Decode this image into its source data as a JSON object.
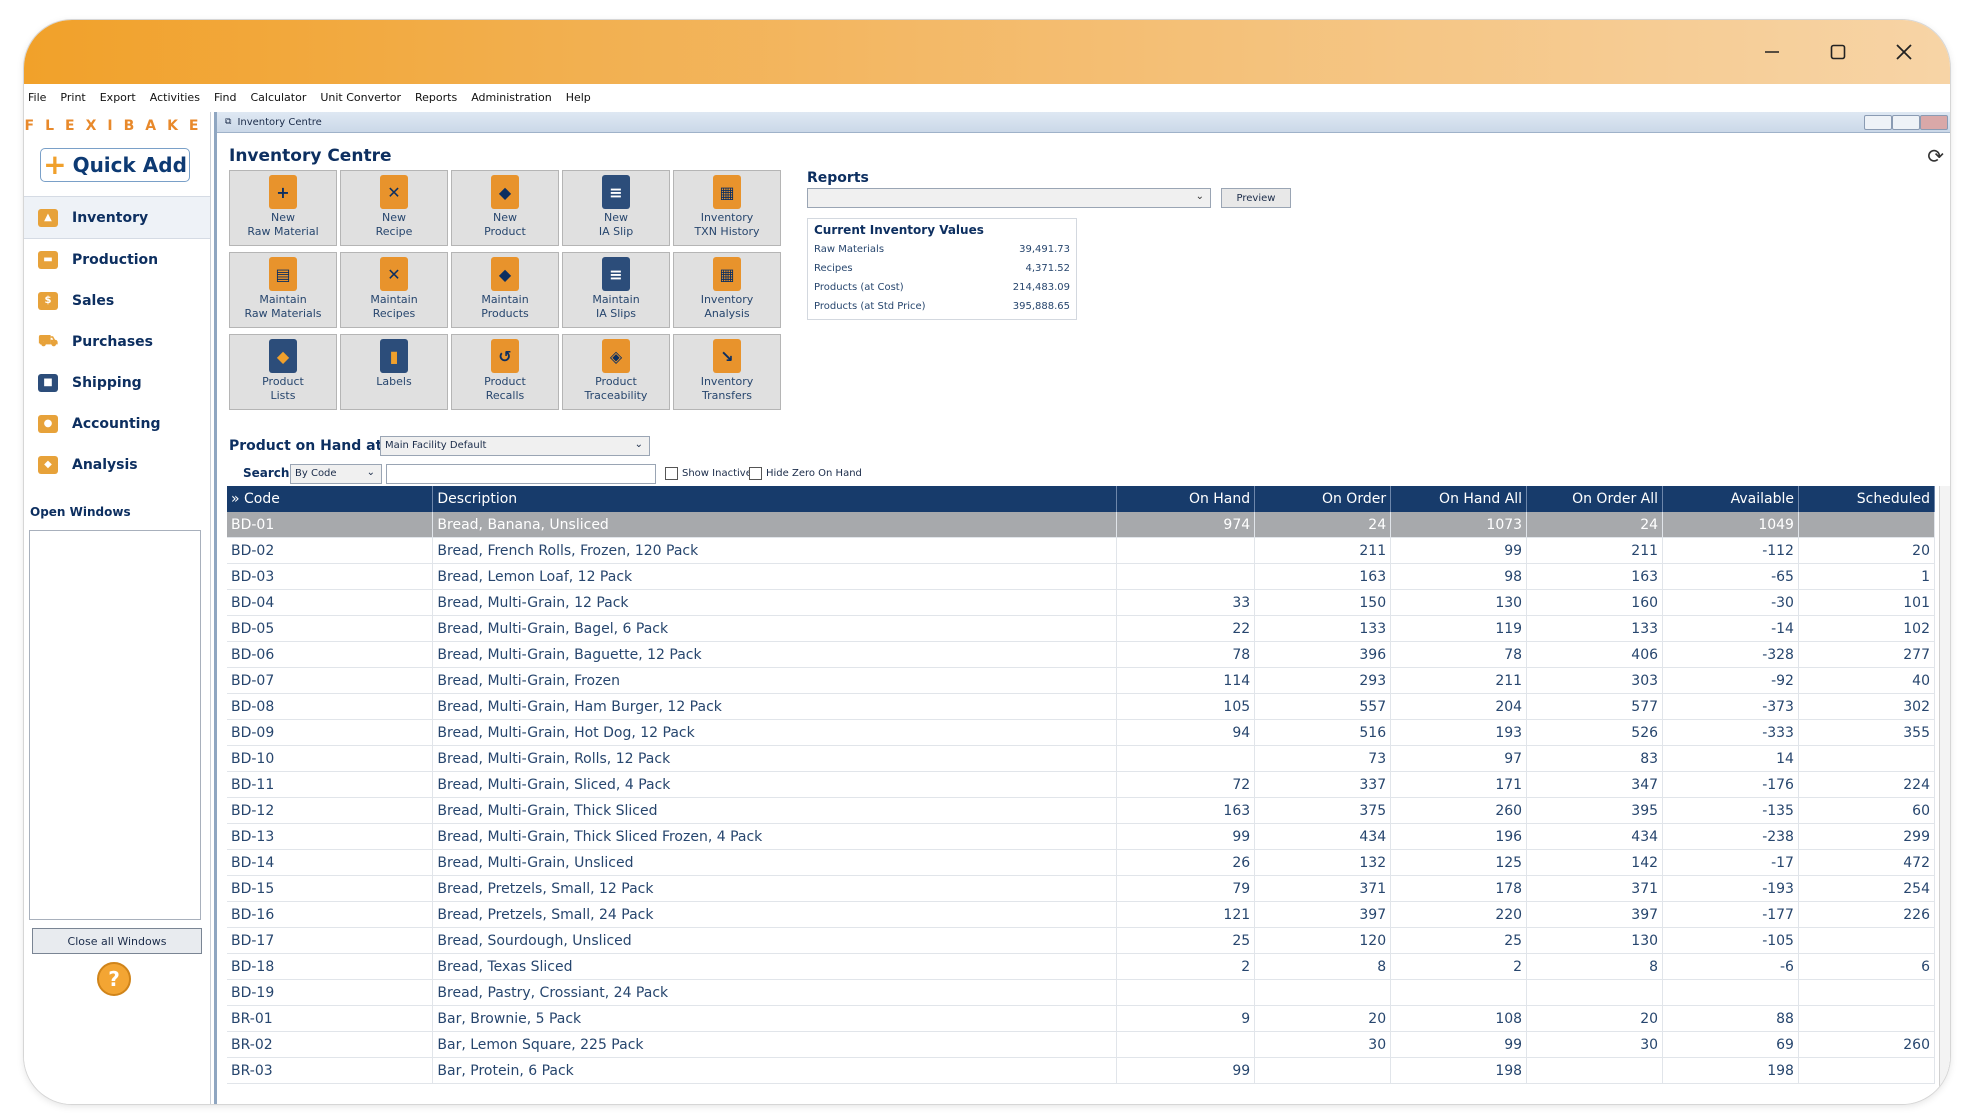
{
  "menu": [
    "File",
    "Print",
    "Export",
    "Activities",
    "Find",
    "Calculator",
    "Unit Convertor",
    "Reports",
    "Administration",
    "Help"
  ],
  "brand": {
    "logo": "FLEXIBAKE",
    "accent": "#f0a02c",
    "navy": "#173b6b"
  },
  "sidebar": {
    "quick_add": "Quick Add",
    "items": [
      {
        "label": "Inventory",
        "icon": "bakery-icon"
      },
      {
        "label": "Production",
        "icon": "production-icon"
      },
      {
        "label": "Sales",
        "icon": "sales-icon"
      },
      {
        "label": "Purchases",
        "icon": "cart-icon"
      },
      {
        "label": "Shipping",
        "icon": "truck-icon"
      },
      {
        "label": "Accounting",
        "icon": "accounting-icon"
      },
      {
        "label": "Analysis",
        "icon": "analysis-icon"
      }
    ],
    "open_windows_label": "Open Windows",
    "close_all": "Close all Windows",
    "help": "?"
  },
  "window": {
    "tab_title": "Inventory Centre",
    "page_title": "Inventory Centre"
  },
  "tiles": [
    {
      "label": "New\nRaw Material",
      "icon": "new-raw-material-icon"
    },
    {
      "label": "New\nRecipe",
      "icon": "new-recipe-icon"
    },
    {
      "label": "New\nProduct",
      "icon": "new-product-icon"
    },
    {
      "label": "New\nIA Slip",
      "icon": "new-ia-slip-icon"
    },
    {
      "label": "Inventory\nTXN History",
      "icon": "txn-history-icon"
    },
    {
      "label": "Maintain\nRaw Materials",
      "icon": "maintain-raw-materials-icon"
    },
    {
      "label": "Maintain\nRecipes",
      "icon": "maintain-recipes-icon"
    },
    {
      "label": "Maintain\nProducts",
      "icon": "maintain-products-icon"
    },
    {
      "label": "Maintain\nIA Slips",
      "icon": "maintain-ia-slips-icon"
    },
    {
      "label": "Inventory\nAnalysis",
      "icon": "inventory-analysis-icon"
    },
    {
      "label": "Product\nLists",
      "icon": "product-lists-icon"
    },
    {
      "label": "Labels",
      "icon": "labels-icon"
    },
    {
      "label": "Product\nRecalls",
      "icon": "product-recalls-icon"
    },
    {
      "label": "Product\nTraceability",
      "icon": "product-traceability-icon"
    },
    {
      "label": "Inventory\nTransfers",
      "icon": "inventory-transfers-icon"
    }
  ],
  "reports": {
    "title": "Reports",
    "selected": "",
    "preview": "Preview",
    "values_title": "Current Inventory Values",
    "values": [
      {
        "label": "Raw Materials",
        "value": "39,491.73"
      },
      {
        "label": "Recipes",
        "value": "4,371.52"
      },
      {
        "label": "Products (at Cost)",
        "value": "214,483.09"
      },
      {
        "label": "Products (at Std Price)",
        "value": "395,888.65"
      }
    ]
  },
  "filters": {
    "poh_label": "Product on Hand at",
    "facility": "Main Facility Default",
    "search_label": "Search",
    "search_mode": "By Code",
    "search_value": "",
    "show_inactive": "Show Inactive",
    "hide_zero": "Hide Zero On Hand"
  },
  "table": {
    "columns": [
      "» Code",
      "Description",
      "On Hand",
      "On Order",
      "On Hand All",
      "On Order All",
      "Available",
      "Scheduled"
    ],
    "selected_row": 0,
    "rows": [
      [
        "BD-01",
        "Bread, Banana, Unsliced",
        "974",
        "24",
        "1073",
        "24",
        "1049",
        ""
      ],
      [
        "BD-02",
        "Bread, French Rolls, Frozen, 120 Pack",
        "",
        "211",
        "99",
        "211",
        "-112",
        "20"
      ],
      [
        "BD-03",
        "Bread, Lemon Loaf, 12 Pack",
        "",
        "163",
        "98",
        "163",
        "-65",
        "1"
      ],
      [
        "BD-04",
        "Bread, Multi-Grain, 12 Pack",
        "33",
        "150",
        "130",
        "160",
        "-30",
        "101"
      ],
      [
        "BD-05",
        "Bread, Multi-Grain, Bagel, 6 Pack",
        "22",
        "133",
        "119",
        "133",
        "-14",
        "102"
      ],
      [
        "BD-06",
        "Bread, Multi-Grain, Baguette, 12 Pack",
        "78",
        "396",
        "78",
        "406",
        "-328",
        "277"
      ],
      [
        "BD-07",
        "Bread, Multi-Grain, Frozen",
        "114",
        "293",
        "211",
        "303",
        "-92",
        "40"
      ],
      [
        "BD-08",
        "Bread, Multi-Grain, Ham Burger, 12 Pack",
        "105",
        "557",
        "204",
        "577",
        "-373",
        "302"
      ],
      [
        "BD-09",
        "Bread, Multi-Grain, Hot Dog, 12 Pack",
        "94",
        "516",
        "193",
        "526",
        "-333",
        "355"
      ],
      [
        "BD-10",
        "Bread, Multi-Grain, Rolls, 12 Pack",
        "",
        "73",
        "97",
        "83",
        "14",
        ""
      ],
      [
        "BD-11",
        "Bread, Multi-Grain, Sliced, 4 Pack",
        "72",
        "337",
        "171",
        "347",
        "-176",
        "224"
      ],
      [
        "BD-12",
        "Bread, Multi-Grain, Thick Sliced",
        "163",
        "375",
        "260",
        "395",
        "-135",
        "60"
      ],
      [
        "BD-13",
        "Bread, Multi-Grain, Thick Sliced Frozen, 4 Pack",
        "99",
        "434",
        "196",
        "434",
        "-238",
        "299"
      ],
      [
        "BD-14",
        "Bread, Multi-Grain, Unsliced",
        "26",
        "132",
        "125",
        "142",
        "-17",
        "472"
      ],
      [
        "BD-15",
        "Bread, Pretzels, Small, 12 Pack",
        "79",
        "371",
        "178",
        "371",
        "-193",
        "254"
      ],
      [
        "BD-16",
        "Bread, Pretzels, Small, 24 Pack",
        "121",
        "397",
        "220",
        "397",
        "-177",
        "226"
      ],
      [
        "BD-17",
        "Bread, Sourdough, Unsliced",
        "25",
        "120",
        "25",
        "130",
        "-105",
        ""
      ],
      [
        "BD-18",
        "Bread, Texas Sliced",
        "2",
        "8",
        "2",
        "8",
        "-6",
        "6"
      ],
      [
        "BD-19",
        "Bread, Pastry, Crossiant, 24 Pack",
        "",
        "",
        "",
        "",
        "",
        ""
      ],
      [
        "BR-01",
        "Bar, Brownie, 5 Pack",
        "9",
        "20",
        "108",
        "20",
        "88",
        ""
      ],
      [
        "BR-02",
        "Bar, Lemon Square, 225 Pack",
        "",
        "30",
        "99",
        "30",
        "69",
        "260"
      ],
      [
        "BR-03",
        "Bar, Protein, 6 Pack",
        "99",
        "",
        "198",
        "",
        "198",
        ""
      ]
    ]
  }
}
